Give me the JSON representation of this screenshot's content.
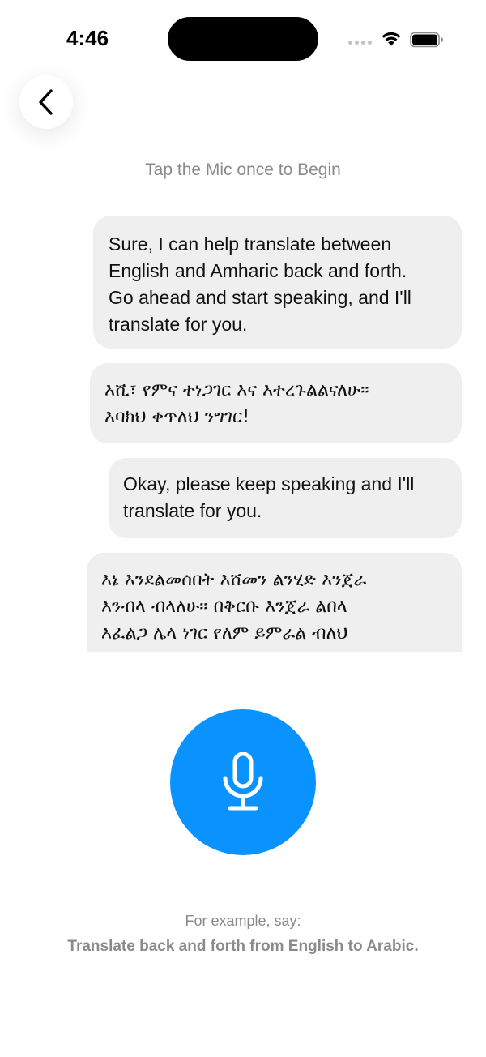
{
  "status_bar": {
    "time": "4:46",
    "icons": [
      "cellular-signal-icon",
      "wifi-icon",
      "battery-icon"
    ]
  },
  "nav": {
    "back_icon": "chevron-left-icon"
  },
  "hint": "Tap the Mic once to Begin",
  "messages": [
    {
      "role": "assistant",
      "text": "Sure, I can help translate between\nEnglish and Amharic back and forth.\nGo ahead and start speaking, and I'll\ntranslate for you."
    },
    {
      "role": "assistant",
      "text": "እሺ፣ የምና ተነጋገር እና እተረጉልልናለሁ፡፡\nእባክህ ቀጥለህ ንግገር!"
    },
    {
      "role": "assistant",
      "text": "Okay, please keep speaking and I'll\ntranslate for you."
    },
    {
      "role": "assistant",
      "text": "እኔ እንደልመሰበት እሸመን ልንሂድ እንጀራ\nእንብላ ብላለሁ፡፡ በቅርቡ እንጀራ ልበላ\nእፈልጋ ሌላ ነገር የለም ይምራል ብለህ\nእባክህ ንገረኝ እንደሆነ ደግሞ ልትረዳኝ"
    }
  ],
  "mic": {
    "icon": "microphone-icon",
    "color": "#0a93ff"
  },
  "example": {
    "label": "For example, say:",
    "text": "Translate back and forth from English to Arabic."
  },
  "colors": {
    "bubble_bg": "#efefef",
    "hint_gray": "#8a8a8e",
    "accent": "#0a93ff"
  }
}
